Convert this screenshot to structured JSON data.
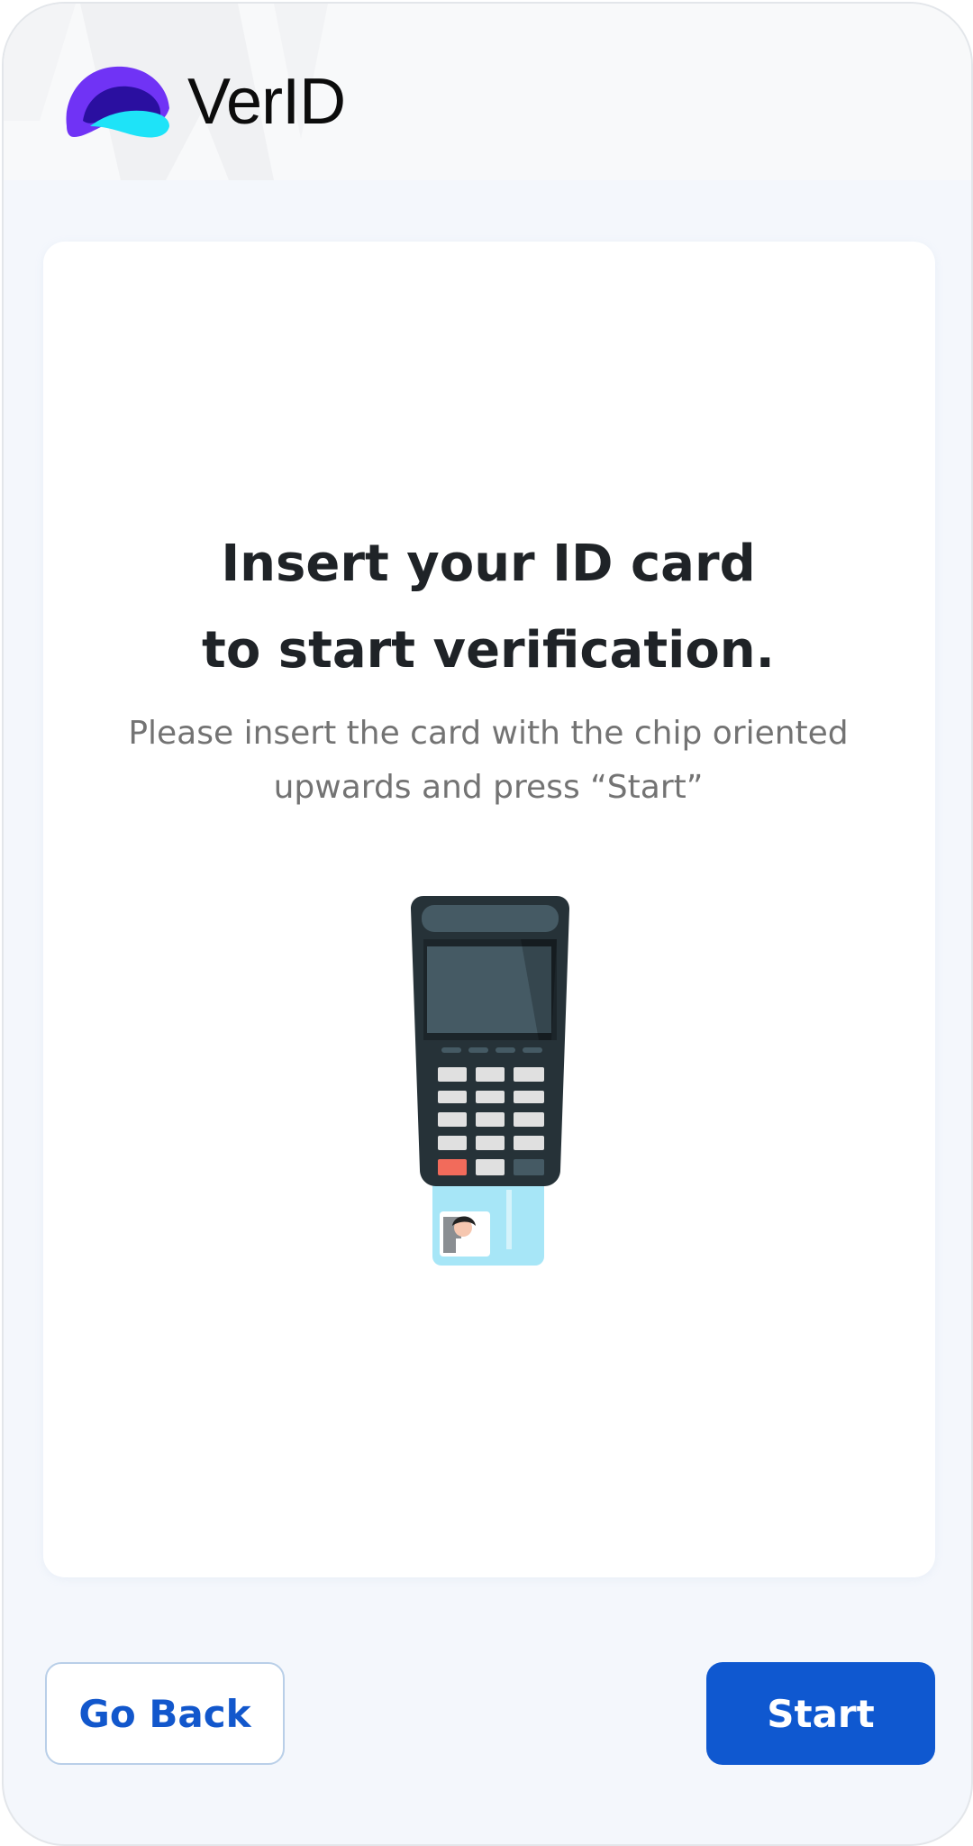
{
  "app": {
    "brand_name": "VerID",
    "logo_icon": "verid-logo-icon"
  },
  "colors": {
    "primary": "#0f58d0",
    "logo_purple": "#7033f5",
    "logo_cyan": "#1ee3f8",
    "text_dark": "#1f2327",
    "text_muted": "#737373"
  },
  "main": {
    "title_line1": "Insert your ID card",
    "title_line2": "to start verification.",
    "subtitle_line1": "Please insert the card with the chip oriented",
    "subtitle_line2": "upwards and press “Start”",
    "illustration_icon": "card-reader-with-id-card-icon"
  },
  "actions": {
    "back_label": "Go Back",
    "start_label": "Start"
  }
}
